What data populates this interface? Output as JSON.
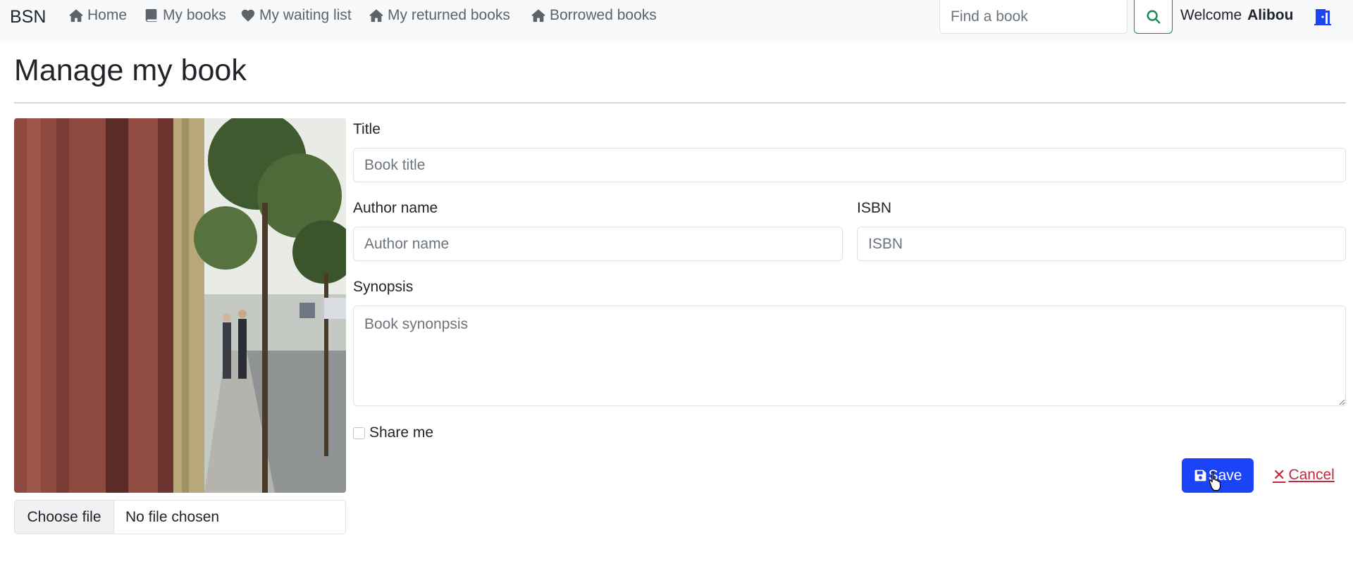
{
  "navbar": {
    "brand": "BSN",
    "items": [
      {
        "label": "Home",
        "icon": "home-icon"
      },
      {
        "label": "My books",
        "icon": "book-icon"
      },
      {
        "label": "My waiting list",
        "icon": "heart-icon"
      },
      {
        "label": "My returned books",
        "icon": "home-icon"
      },
      {
        "label": "Borrowed books",
        "icon": "home-icon"
      }
    ],
    "search_placeholder": "Find a book",
    "welcome_text": "Welcome",
    "user_name": "Alibou"
  },
  "page": {
    "title": "Manage my book"
  },
  "file_input": {
    "button_label": "Choose file",
    "status": "No file chosen"
  },
  "form": {
    "title_label": "Title",
    "title_placeholder": "Book title",
    "author_label": "Author name",
    "author_placeholder": "Author name",
    "isbn_label": "ISBN",
    "isbn_placeholder": "ISBN",
    "synopsis_label": "Synopsis",
    "synopsis_placeholder": "Book synonpsis",
    "share_label": "Share me",
    "share_checked": false
  },
  "actions": {
    "save_label": "Save",
    "cancel_label": "Cancel"
  },
  "colors": {
    "primary": "#1a44f5",
    "danger": "#c0283b",
    "success": "#198754",
    "navbar_bg": "#f8f9fa"
  }
}
